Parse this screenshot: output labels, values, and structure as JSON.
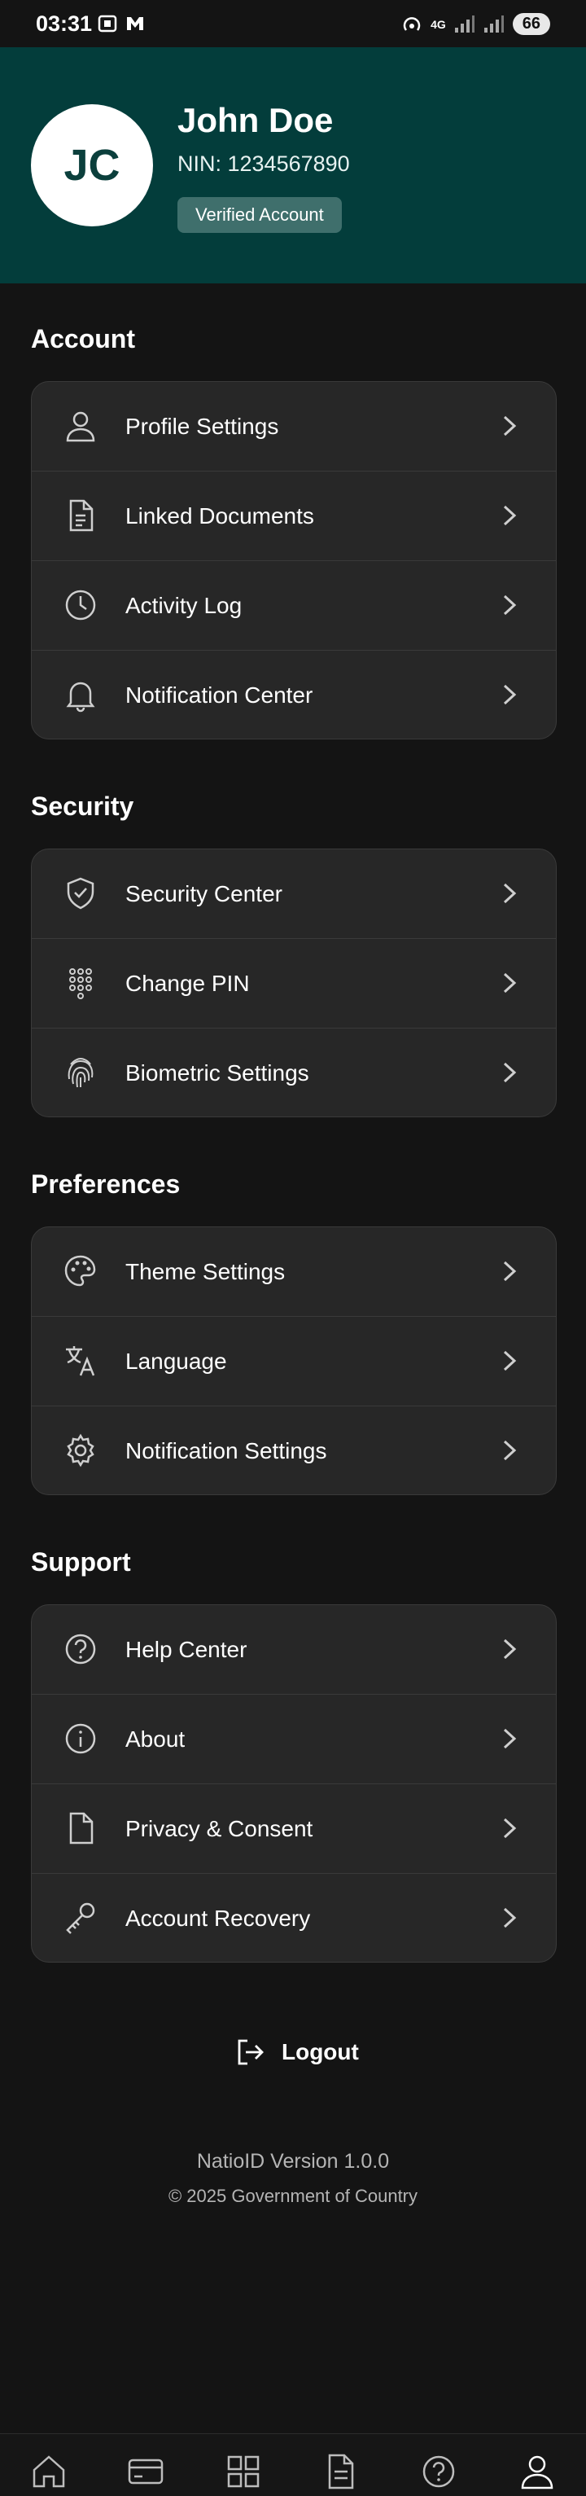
{
  "status_bar": {
    "time": "03:31",
    "battery": "66",
    "network": "4G"
  },
  "profile": {
    "initials": "JC",
    "name": "John Doe",
    "nin": "NIN: 1234567890",
    "badge": "Verified Account"
  },
  "sections": {
    "account": {
      "title": "Account",
      "items": [
        {
          "label": "Profile Settings",
          "icon": "user-icon"
        },
        {
          "label": "Linked Documents",
          "icon": "document-icon"
        },
        {
          "label": "Activity Log",
          "icon": "clock-icon"
        },
        {
          "label": "Notification Center",
          "icon": "bell-icon"
        }
      ]
    },
    "security": {
      "title": "Security",
      "items": [
        {
          "label": "Security Center",
          "icon": "shield-check-icon"
        },
        {
          "label": "Change PIN",
          "icon": "keypad-icon"
        },
        {
          "label": "Biometric Settings",
          "icon": "fingerprint-icon"
        }
      ]
    },
    "preferences": {
      "title": "Preferences",
      "items": [
        {
          "label": "Theme Settings",
          "icon": "palette-icon"
        },
        {
          "label": "Language",
          "icon": "translate-icon"
        },
        {
          "label": "Notification Settings",
          "icon": "gear-icon"
        }
      ]
    },
    "support": {
      "title": "Support",
      "items": [
        {
          "label": "Help Center",
          "icon": "help-circle-icon"
        },
        {
          "label": "About",
          "icon": "info-icon"
        },
        {
          "label": "Privacy & Consent",
          "icon": "file-icon"
        },
        {
          "label": "Account Recovery",
          "icon": "key-icon"
        }
      ]
    }
  },
  "logout_label": "Logout",
  "footer": {
    "version": "NatioID Version 1.0.0",
    "copyright": "© 2025 Government of Country"
  },
  "bottom_nav": [
    "home-icon",
    "card-icon",
    "grid-icon",
    "document-icon",
    "help-icon",
    "profile-icon"
  ],
  "colors": {
    "header_bg": "#033d3b",
    "card_bg": "#272727",
    "page_bg": "#141414",
    "badge_bg": "#3f6f6c"
  }
}
